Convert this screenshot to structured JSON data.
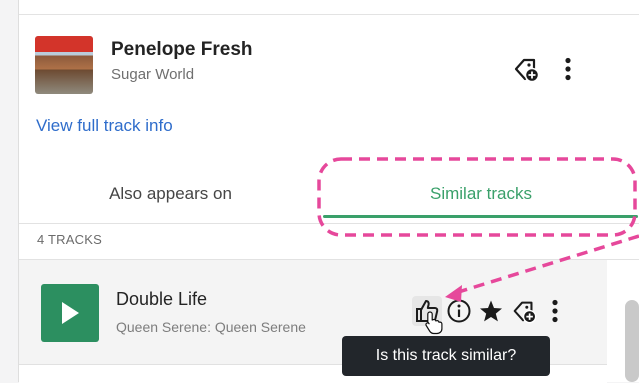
{
  "track": {
    "title": "Penelope Fresh",
    "artist": "Sugar World",
    "view_link": "View full track info"
  },
  "tabs": [
    {
      "label": "Also appears on",
      "active": false
    },
    {
      "label": "Similar tracks",
      "active": true
    }
  ],
  "list": {
    "count_label": "4 TRACKS",
    "items": [
      {
        "title": "Double Life",
        "subtitle": "Queen Serene: Queen Serene"
      }
    ]
  },
  "tooltip": {
    "text": "Is this track similar?"
  },
  "icons": {
    "tag": "tag-add-icon",
    "more": "more-vertical-icon",
    "thumb": "thumbs-up-icon",
    "info": "info-icon",
    "star": "star-icon",
    "play": "play-icon"
  },
  "colors": {
    "accent": "#3aa06a",
    "link": "#2f6dcb",
    "annotation": "#e6489b",
    "tooltip_bg": "#22262b"
  }
}
